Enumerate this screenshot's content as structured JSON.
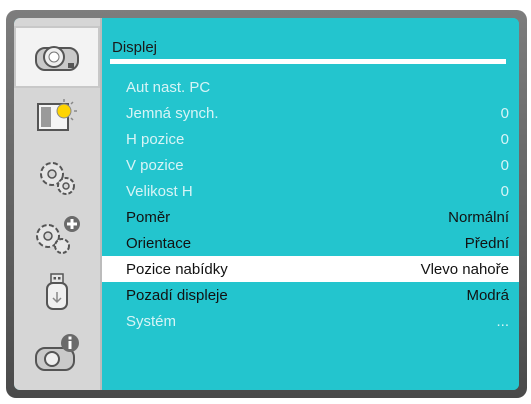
{
  "sidebar": {
    "items": [
      {
        "name": "projector-icon",
        "active": true
      },
      {
        "name": "picture-adjust-icon",
        "active": false
      },
      {
        "name": "settings-icon",
        "active": false
      },
      {
        "name": "advanced-settings-icon",
        "active": false
      },
      {
        "name": "usb-icon",
        "active": false
      },
      {
        "name": "info-icon",
        "active": false
      }
    ]
  },
  "panel": {
    "title": "Displej",
    "rows": [
      {
        "label": "Aut nast. PC",
        "value": "",
        "state": "disabled"
      },
      {
        "label": "Jemná synch.",
        "value": "0",
        "state": "disabled"
      },
      {
        "label": "H pozice",
        "value": "0",
        "state": "disabled"
      },
      {
        "label": "V pozice",
        "value": "0",
        "state": "disabled"
      },
      {
        "label": "Velikost H",
        "value": "0",
        "state": "disabled"
      },
      {
        "label": "Poměr",
        "value": "Normální",
        "state": "enabled"
      },
      {
        "label": "Orientace",
        "value": "Přední",
        "state": "enabled"
      },
      {
        "label": "Pozice nabídky",
        "value": "Vlevo nahoře",
        "state": "selected"
      },
      {
        "label": "Pozadí displeje",
        "value": "Modrá",
        "state": "enabled"
      },
      {
        "label": "Systém",
        "value": "...",
        "state": "disabled"
      }
    ]
  },
  "colors": {
    "panel_bg": "#23c5ce",
    "sidebar_bg": "#d6d6d6",
    "selected_bg": "#ffffff",
    "disabled_text": "#d7f4f6"
  }
}
